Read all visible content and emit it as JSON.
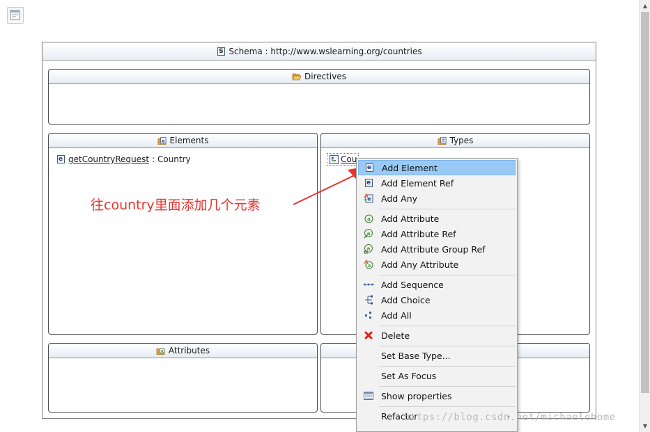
{
  "schema": {
    "title": "Schema : http://www.wslearning.org/countries"
  },
  "directives": {
    "title": "Directives"
  },
  "elements": {
    "title": "Elements",
    "items": [
      {
        "name": "getCountryRequest",
        "type": " : Country"
      }
    ]
  },
  "types": {
    "title": "Types",
    "items": [
      {
        "name": "Cou"
      }
    ]
  },
  "attributes": {
    "title": "Attributes"
  },
  "annotation": {
    "text": "往country里面添加几个元素"
  },
  "context_menu": {
    "items": [
      {
        "label": "Add Element"
      },
      {
        "label": "Add Element Ref"
      },
      {
        "label": "Add Any"
      },
      {
        "label": "Add Attribute"
      },
      {
        "label": "Add Attribute Ref"
      },
      {
        "label": "Add Attribute Group Ref"
      },
      {
        "label": "Add Any Attribute"
      },
      {
        "label": "Add Sequence"
      },
      {
        "label": "Add Choice"
      },
      {
        "label": "Add All"
      },
      {
        "label": "Delete"
      },
      {
        "label": "Set Base Type..."
      },
      {
        "label": "Set As Focus"
      },
      {
        "label": "Show properties"
      },
      {
        "label": "Refactor"
      }
    ]
  },
  "watermark": {
    "text": "https://blog.csdn.net/michaelehome"
  },
  "colors": {
    "selection": "#99c9f5",
    "annotation": "#e8332d",
    "arrow": "#e8332d"
  }
}
